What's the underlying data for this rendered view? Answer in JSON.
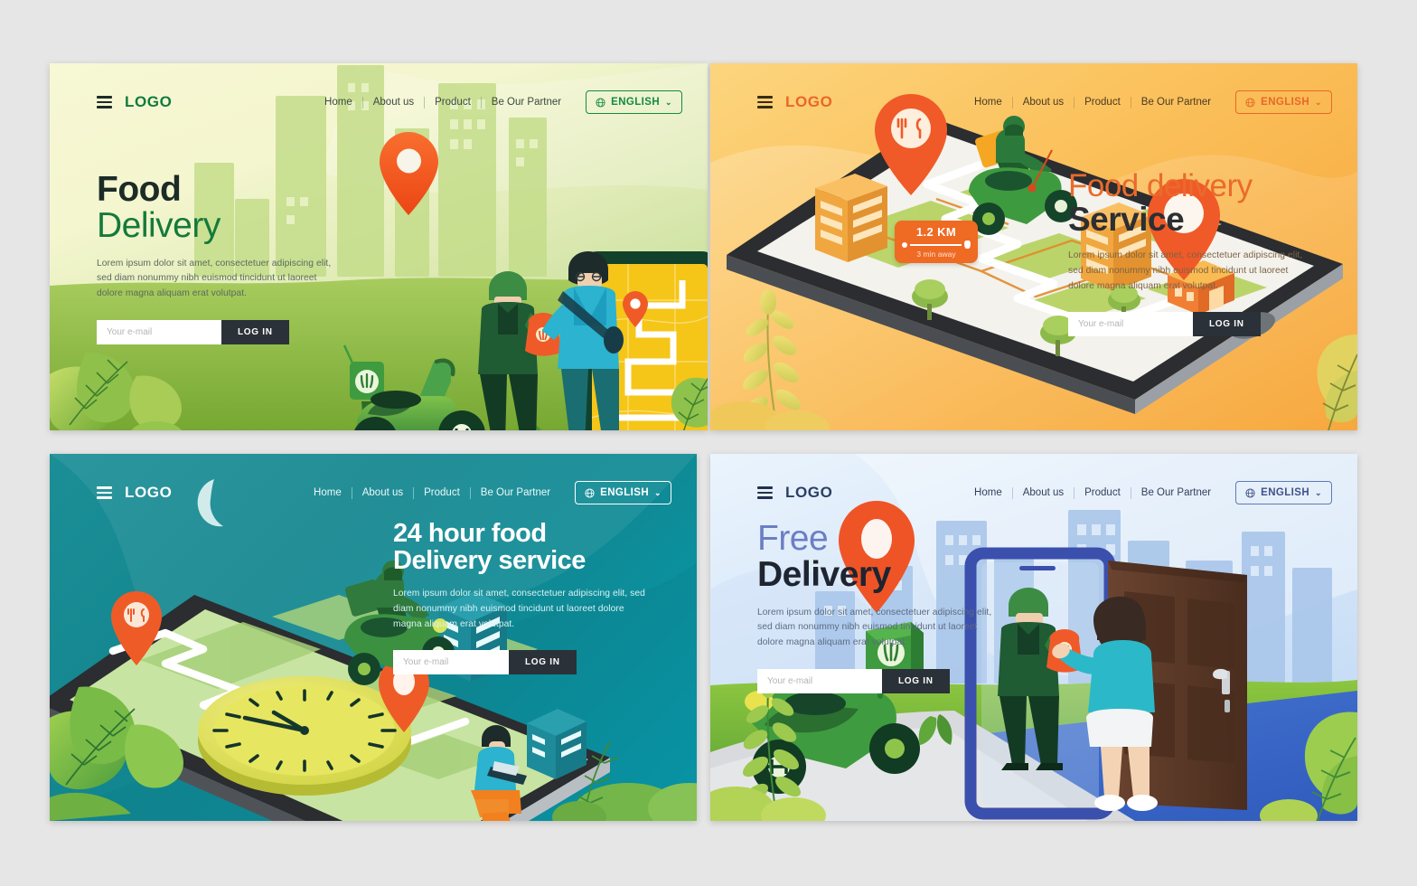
{
  "panels": [
    {
      "id": "food-delivery-green",
      "nav": {
        "logo": "LOGO",
        "menu_icon": "hamburger-icon",
        "links": [
          "Home",
          "About us",
          "Product",
          "Be Our Partner"
        ],
        "language": "ENGLISH",
        "language_icon": "globe-icon",
        "caret_icon": "chevron-down-icon"
      },
      "hero": {
        "title_line1": "Food",
        "title_line2": "Delivery",
        "paragraph": "Lorem ipsum dolor sit amet, consectetuer adipiscing elit, sed diam nonummy nibh euismod tincidunt ut laoreet dolore magna aliquam erat volutpat.",
        "email_placeholder": "Your e-mail",
        "email_value": "",
        "login_label": "LOG IN"
      },
      "colors": {
        "accent": "#147a3c",
        "dark": "#1d2b27",
        "pin": "#f05a28",
        "map": "#f5c518",
        "bg_start": "#f7f8d4",
        "bg_end": "#b4d684"
      },
      "illustration": {
        "name": "courier-handing-food-to-customer-with-phone-map",
        "elements": [
          "scooter",
          "courier",
          "customer",
          "giant-phone",
          "map-screen",
          "location-pin",
          "city-skyline",
          "bushes"
        ]
      }
    },
    {
      "id": "food-delivery-service-orange",
      "nav": {
        "logo": "LOGO",
        "menu_icon": "hamburger-icon",
        "links": [
          "Home",
          "About us",
          "Product",
          "Be Our Partner"
        ],
        "language": "ENGLISH",
        "language_icon": "globe-icon",
        "caret_icon": "chevron-down-icon"
      },
      "hero": {
        "title_line1": "Food delivery",
        "title_line2": "Service",
        "paragraph": "Lorem ipsum dolor sit amet, consectetuer adipiscing elit, sed diam nonummy nibh euismod tincidunt ut laoreet dolore magna aliquam erat volutpat.",
        "email_placeholder": "Your e-mail",
        "email_value": "",
        "login_label": "LOG IN"
      },
      "badge": {
        "distance": "1.2 KM",
        "eta": "3 min away"
      },
      "colors": {
        "accent": "#ea6a2b",
        "dark": "#2c2f33",
        "pin": "#f05a28",
        "bg_start": "#fcd57e",
        "bg_end": "#f7a63a"
      },
      "illustration": {
        "name": "isometric-phone-map-with-scooter-route",
        "elements": [
          "isometric-phone",
          "map-roads",
          "restaurant-pin",
          "destination-pin",
          "scooter-rider",
          "buildings",
          "trees",
          "house",
          "distance-badge"
        ]
      }
    },
    {
      "id": "24-hour-delivery-teal",
      "nav": {
        "logo": "LOGO",
        "menu_icon": "hamburger-icon",
        "links": [
          "Home",
          "About us",
          "Product",
          "Be Our Partner"
        ],
        "language": "ENGLISH",
        "language_icon": "globe-icon",
        "caret_icon": "chevron-down-icon"
      },
      "hero": {
        "title_line1": "24 hour food",
        "title_line2": "Delivery service",
        "paragraph": "Lorem ipsum dolor sit amet, consectetuer adipiscing elit, sed diam nonummy nibh euismod tincidunt ut laoreet dolore magna aliquam erat volutpat.",
        "email_placeholder": "Your e-mail",
        "email_value": "",
        "login_label": "LOG IN"
      },
      "colors": {
        "accent": "#ffffff",
        "dark": "#2b3138",
        "pin": "#f05a28",
        "clock": "#e8e05a",
        "bg_start": "#1b8e96",
        "bg_end": "#06a0b3"
      },
      "illustration": {
        "name": "isometric-phone-with-clock-and-night-scooter",
        "elements": [
          "isometric-phone",
          "giant-clock",
          "moon",
          "scooter-rider",
          "seated-person-with-laptop",
          "location-pins",
          "buildings",
          "leaves"
        ]
      }
    },
    {
      "id": "free-delivery-blue",
      "nav": {
        "logo": "LOGO",
        "menu_icon": "hamburger-icon",
        "links": [
          "Home",
          "About us",
          "Product",
          "Be Our Partner"
        ],
        "language": "ENGLISH",
        "language_icon": "globe-icon",
        "caret_icon": "chevron-down-icon"
      },
      "hero": {
        "title_line1": "Free",
        "title_line2": "Delivery",
        "paragraph": "Lorem ipsum dolor sit amet, consectetuer adipiscing elit, sed diam nonummy nibh euismod tincidunt ut laoreet dolore magna aliquam erat volutpat.",
        "email_placeholder": "Your e-mail",
        "email_value": "",
        "login_label": "LOG IN"
      },
      "colors": {
        "accent": "#6b7ec4",
        "dark": "#1e2430",
        "pin": "#f0502a",
        "door": "#5b3a28",
        "bg_start": "#eaf4fd",
        "bg_end": "#bdd8f5"
      },
      "illustration": {
        "name": "courier-delivering-to-woman-at-door-through-phone",
        "elements": [
          "scooter",
          "delivery-box",
          "location-pin",
          "phone-frame",
          "courier",
          "woman",
          "front-door",
          "city-skyline",
          "bushes"
        ]
      }
    }
  ]
}
